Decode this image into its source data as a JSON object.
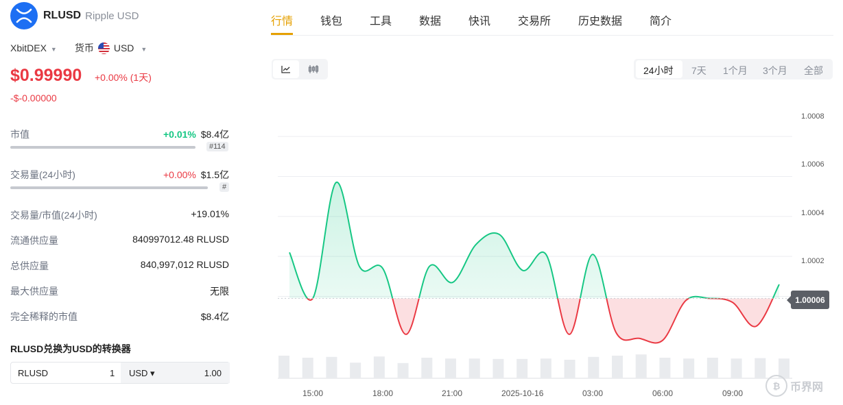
{
  "coin": {
    "symbol": "RLUSD",
    "name": "Ripple USD"
  },
  "selectors": {
    "exchange": "XbitDEX",
    "currency_label": "货币",
    "currency": "USD"
  },
  "price": {
    "value": "$0.99990",
    "change_pct": "+0.00% (1天)",
    "change_abs": "-$-0.00000"
  },
  "stats": {
    "market_cap": {
      "label": "市值",
      "change": "+0.01%",
      "value": "$8.4亿",
      "rank": "#114",
      "bar_fraction": 0.92
    },
    "volume": {
      "label": "交易量(24小时)",
      "change": "+0.00%",
      "value": "$1.5亿",
      "rank": "#",
      "bar_fraction": 0.9
    },
    "vol_mcap": {
      "label": "交易量/市值(24小时)",
      "value": "+19.01%"
    },
    "circulating": {
      "label": "流通供应量",
      "value": "840997012.48 RLUSD"
    },
    "total": {
      "label": "总供应量",
      "value": "840,997,012 RLUSD"
    },
    "max": {
      "label": "最大供应量",
      "value": "无限"
    },
    "fdv": {
      "label": "完全稀释的市值",
      "value": "$8.4亿"
    }
  },
  "converter": {
    "title": "RLUSD兑换为USD的转换器",
    "from_sym": "RLUSD",
    "from_val": "1",
    "to_sym": "USD ▾",
    "to_val": "1.00"
  },
  "tabs": [
    "行情",
    "钱包",
    "工具",
    "数据",
    "快讯",
    "交易所",
    "历史数据",
    "简介"
  ],
  "ranges": [
    "24小时",
    "7天",
    "1个月",
    "3个月",
    "全部"
  ],
  "chart_data": {
    "type": "area",
    "x": [
      "14:00",
      "15:00",
      "16:00",
      "17:00",
      "18:00",
      "19:00",
      "20:00",
      "21:00",
      "22:00",
      "23:00",
      "2025-10-16",
      "01:00",
      "02:00",
      "03:00",
      "04:00",
      "05:00",
      "06:00",
      "07:00",
      "08:00",
      "09:00",
      "10:00",
      "11:00"
    ],
    "values": [
      1.00022,
      0.99999,
      1.00057,
      1.00015,
      1.00014,
      0.99981,
      1.00015,
      1.00007,
      1.00026,
      1.00031,
      1.00013,
      1.00021,
      0.99981,
      1.00021,
      0.99982,
      0.99979,
      0.99978,
      0.99998,
      0.99999,
      0.99997,
      0.99985,
      1.00006
    ],
    "baseline": 0.99999,
    "y_ticks": [
      "1.0008",
      "1.0006",
      "1.0004",
      "1.0002"
    ],
    "x_ticks": [
      "15:00",
      "18:00",
      "21:00",
      "2025-10-16",
      "03:00",
      "06:00",
      "09:00"
    ],
    "ylim": [
      0.9997,
      1.0009
    ],
    "current_price_label": "1.00006",
    "volume": [
      0.55,
      0.5,
      0.52,
      0.38,
      0.53,
      0.37,
      0.5,
      0.48,
      0.48,
      0.47,
      0.47,
      0.48,
      0.45,
      0.52,
      0.55,
      0.58,
      0.5,
      0.48,
      0.5,
      0.48,
      0.49,
      0.48
    ],
    "colors": {
      "up": "#16c784",
      "down": "#ea3943"
    },
    "grid": true
  },
  "watermark": "币界网"
}
